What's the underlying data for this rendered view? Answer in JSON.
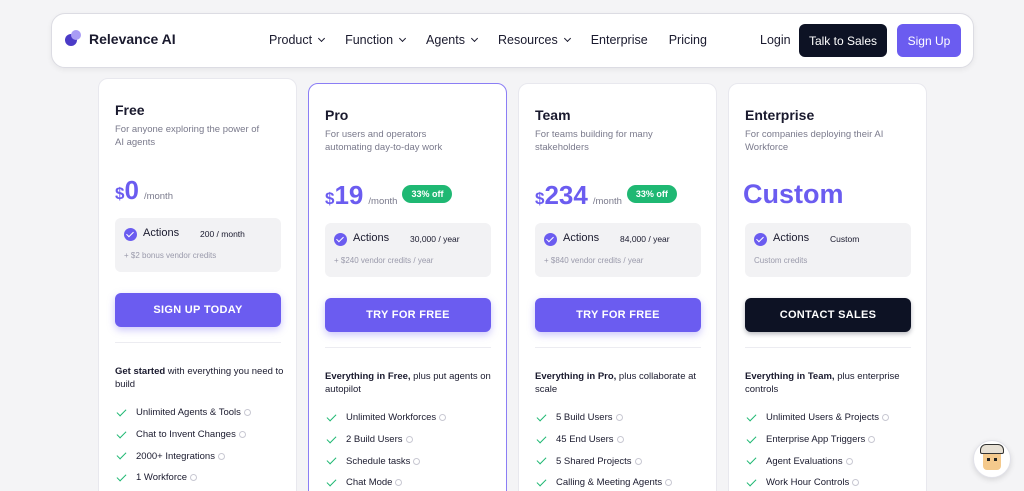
{
  "nav": {
    "brand": "Relevance AI",
    "links": [
      "Product",
      "Function",
      "Agents",
      "Resources",
      "Enterprise",
      "Pricing"
    ],
    "login": "Login",
    "talk_to_sales": "Talk to Sales",
    "sign_up": "Sign Up"
  },
  "colors": {
    "accent": "#6b5cf0",
    "dark": "#0d1224",
    "green": "#1fb873"
  },
  "plans": [
    {
      "name": "Free",
      "desc": "For anyone exploring the power of AI agents",
      "currency": "$",
      "price": "0",
      "period": "/month",
      "actions_label": "Actions",
      "actions_value": "200 / month",
      "actions_sub": "+ $2 bonus vendor credits",
      "cta": "SIGN UP TODAY",
      "intro_bold": "Get started",
      "intro_rest": " with everything you need to build",
      "features": [
        "Unlimited Agents & Tools",
        "Chat to Invent Changes",
        "2000+ Integrations",
        "1 Workforce"
      ]
    },
    {
      "name": "Pro",
      "desc": "For users and operators automating day-to-day work",
      "currency": "$",
      "price": "19",
      "period": "/month",
      "badge": "33% off",
      "actions_label": "Actions",
      "actions_value": "30,000 / year",
      "actions_sub": "+ $240 vendor credits / year",
      "cta": "TRY FOR FREE",
      "intro_bold": "Everything in Free,",
      "intro_rest": " plus put agents on autopilot",
      "features": [
        "Unlimited Workforces",
        "2 Build Users",
        "Schedule tasks",
        "Chat Mode"
      ]
    },
    {
      "name": "Team",
      "desc": "For teams building for many stakeholders",
      "currency": "$",
      "price": "234",
      "period": "/month",
      "badge": "33% off",
      "actions_label": "Actions",
      "actions_value": "84,000 / year",
      "actions_sub": "+ $840 vendor credits / year",
      "cta": "TRY FOR FREE",
      "intro_bold": "Everything in Pro,",
      "intro_rest": " plus collaborate at scale",
      "features": [
        "5 Build Users",
        "45 End Users",
        "5 Shared Projects",
        "Calling & Meeting Agents"
      ]
    },
    {
      "name": "Enterprise",
      "desc": "For companies deploying their AI Workforce",
      "price_custom": "Custom",
      "actions_label": "Actions",
      "actions_value": "Custom",
      "actions_sub": "Custom credits",
      "cta": "CONTACT SALES",
      "intro_bold": "Everything in Team,",
      "intro_rest": " plus enterprise controls",
      "features": [
        "Unlimited Users & Projects",
        "Enterprise App Triggers",
        "Agent Evaluations",
        "Work Hour Controls"
      ]
    }
  ]
}
